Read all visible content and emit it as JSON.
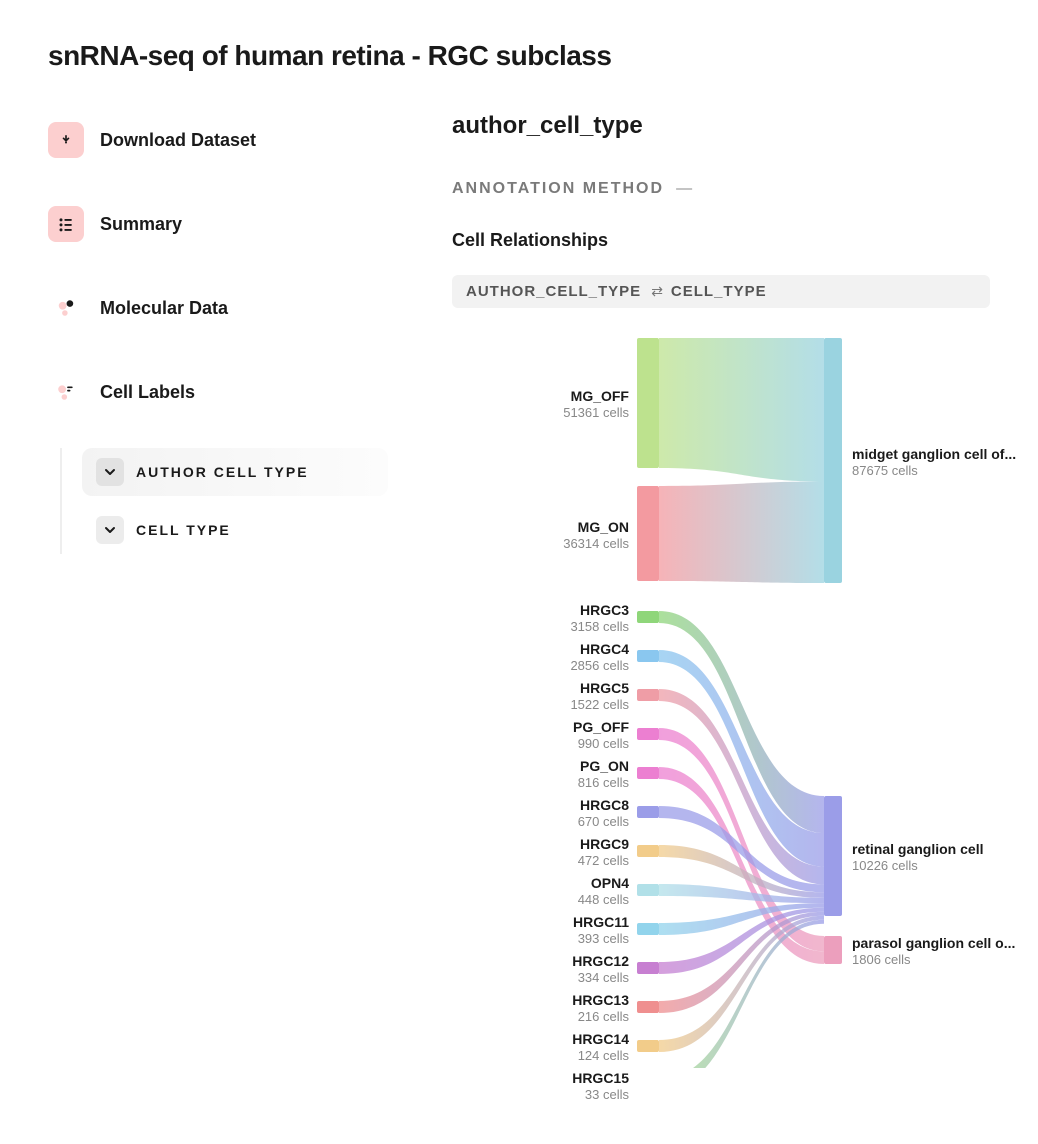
{
  "page_title": "snRNA-seq of human retina - RGC subclass",
  "sidebar": {
    "download": "Download Dataset",
    "summary": "Summary",
    "molecular": "Molecular Data",
    "cell_labels": "Cell Labels",
    "sub": {
      "author_cell_type": "AUTHOR CELL TYPE",
      "cell_type": "CELL TYPE"
    }
  },
  "main": {
    "section_title": "author_cell_type",
    "annotation_label": "ANNOTATION METHOD",
    "annotation_value": "—",
    "relationships_title": "Cell Relationships",
    "chip_left": "AUTHOR_CELL_TYPE",
    "chip_right": "CELL_TYPE"
  },
  "chart_data": {
    "type": "sankey",
    "left_nodes": [
      {
        "name": "MG_OFF",
        "cells": 51361,
        "color": "#bde28e"
      },
      {
        "name": "MG_ON",
        "cells": 36314,
        "color": "#f39aa0"
      },
      {
        "name": "HRGC3",
        "cells": 3158,
        "color": "#8fd67a"
      },
      {
        "name": "HRGC4",
        "cells": 2856,
        "color": "#8ac7ef"
      },
      {
        "name": "HRGC5",
        "cells": 1522,
        "color": "#ef9da6"
      },
      {
        "name": "PG_OFF",
        "cells": 990,
        "color": "#ec7fd1"
      },
      {
        "name": "PG_ON",
        "cells": 816,
        "color": "#ec7fd1"
      },
      {
        "name": "HRGC8",
        "cells": 670,
        "color": "#9b9de8"
      },
      {
        "name": "HRGC9",
        "cells": 472,
        "color": "#f2cc8a"
      },
      {
        "name": "OPN4",
        "cells": 448,
        "color": "#b1e0e8"
      },
      {
        "name": "HRGC11",
        "cells": 393,
        "color": "#92d4ec"
      },
      {
        "name": "HRGC12",
        "cells": 334,
        "color": "#c77fd1"
      },
      {
        "name": "HRGC13",
        "cells": 216,
        "color": "#ef8f8f"
      },
      {
        "name": "HRGC14",
        "cells": 124,
        "color": "#f2cc8a"
      },
      {
        "name": "HRGC15",
        "cells": 33,
        "color": "#a6e08a"
      }
    ],
    "right_nodes": [
      {
        "name": "midget ganglion cell of...",
        "cells": 87675,
        "color": "#9ad3e0"
      },
      {
        "name": "retinal ganglion cell",
        "cells": 10226,
        "color": "#9b9de8"
      },
      {
        "name": "parasol ganglion cell o...",
        "cells": 1806,
        "color": "#ec9fbd"
      }
    ],
    "links": [
      {
        "source": "MG_OFF",
        "target": "midget ganglion cell of..."
      },
      {
        "source": "MG_ON",
        "target": "midget ganglion cell of..."
      },
      {
        "source": "HRGC3",
        "target": "retinal ganglion cell"
      },
      {
        "source": "HRGC4",
        "target": "retinal ganglion cell"
      },
      {
        "source": "HRGC5",
        "target": "retinal ganglion cell"
      },
      {
        "source": "PG_OFF",
        "target": "parasol ganglion cell o..."
      },
      {
        "source": "PG_ON",
        "target": "parasol ganglion cell o..."
      },
      {
        "source": "HRGC8",
        "target": "retinal ganglion cell"
      },
      {
        "source": "HRGC9",
        "target": "retinal ganglion cell"
      },
      {
        "source": "OPN4",
        "target": "retinal ganglion cell"
      },
      {
        "source": "HRGC11",
        "target": "retinal ganglion cell"
      },
      {
        "source": "HRGC12",
        "target": "retinal ganglion cell"
      },
      {
        "source": "HRGC13",
        "target": "retinal ganglion cell"
      },
      {
        "source": "HRGC14",
        "target": "retinal ganglion cell"
      },
      {
        "source": "HRGC15",
        "target": "retinal ganglion cell"
      }
    ]
  }
}
